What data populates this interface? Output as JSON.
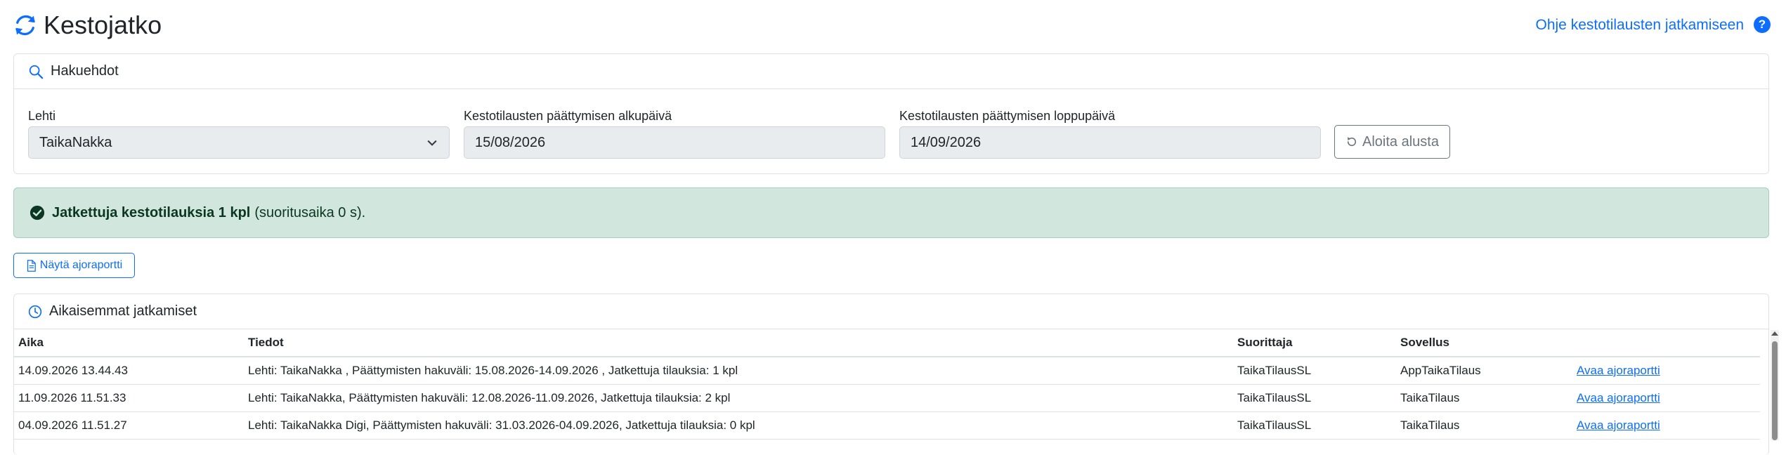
{
  "header": {
    "title": "Kestojatko",
    "help_link": "Ohje kestotilausten jatkamiseen",
    "help_icon": "?"
  },
  "search": {
    "title": "Hakuehdot",
    "fields": {
      "paper_label": "Lehti",
      "paper_value": "TaikaNakka",
      "start_label": "Kestotilausten päättymisen alkupäivä",
      "start_value": "15/08/2026",
      "end_label": "Kestotilausten päättymisen loppupäivä",
      "end_value": "14/09/2026"
    },
    "reset_label": "Aloita alusta"
  },
  "alert": {
    "strong": "Jatkettuja kestotilauksia 1 kpl",
    "rest": "(suoritusaika 0 s)."
  },
  "report_button": "Näytä ajoraportti",
  "history": {
    "title": "Aikaisemmat jatkamiset",
    "columns": [
      "Aika",
      "Tiedot",
      "Suorittaja",
      "Sovellus",
      ""
    ],
    "rows": [
      [
        "14.09.2026 13.44.43",
        "Lehti: TaikaNakka , Päättymisten hakuväli: 15.08.2026-14.09.2026 , Jatkettuja tilauksia: 1 kpl",
        "TaikaTilausSL",
        "AppTaikaTilaus",
        "Avaa ajoraportti"
      ],
      [
        "11.09.2026 11.51.33",
        "Lehti: TaikaNakka, Päättymisten hakuväli: 12.08.2026-11.09.2026, Jatkettuja tilauksia: 2 kpl",
        "TaikaTilausSL",
        "TaikaTilaus",
        "Avaa ajoraportti"
      ],
      [
        "04.09.2026 11.51.27",
        "Lehti: TaikaNakka Digi, Päättymisten hakuväli: 31.03.2026-04.09.2026, Jatkettuja tilauksia: 0 kpl",
        "TaikaTilausSL",
        "TaikaTilaus",
        "Avaa ajoraportti"
      ]
    ]
  },
  "colors": {
    "primary": "#0d6efd",
    "success_bg": "#d1e7dd",
    "success_text": "#0a3622",
    "field_bg": "#e9ecef"
  }
}
